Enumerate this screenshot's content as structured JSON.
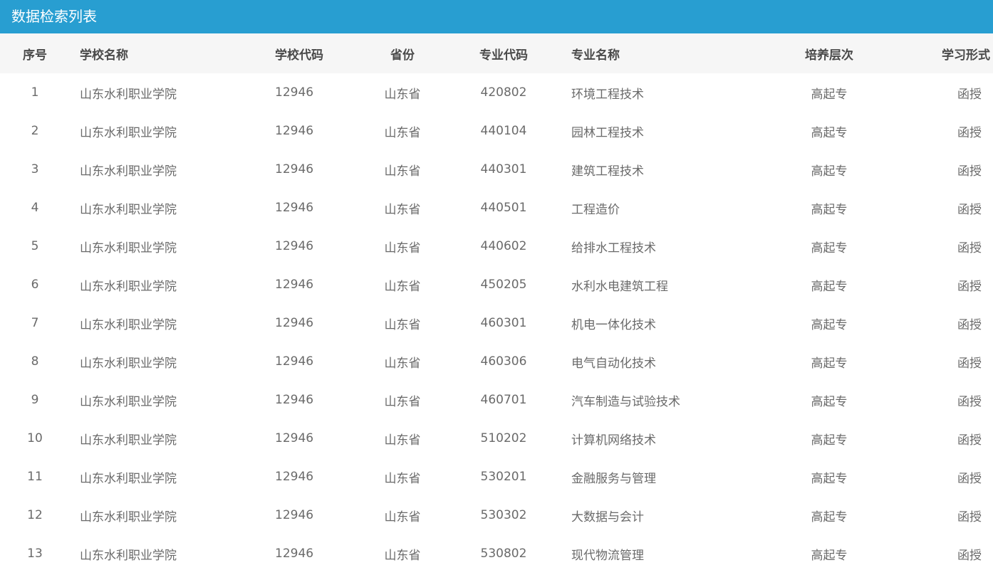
{
  "panel": {
    "title": "数据检索列表"
  },
  "table": {
    "columns": [
      "序号",
      "学校名称",
      "学校代码",
      "省份",
      "专业代码",
      "专业名称",
      "培养层次",
      "学习形式"
    ],
    "rows": [
      [
        "1",
        "山东水利职业学院",
        "12946",
        "山东省",
        "420802",
        "环境工程技术",
        "高起专",
        "函授"
      ],
      [
        "2",
        "山东水利职业学院",
        "12946",
        "山东省",
        "440104",
        "园林工程技术",
        "高起专",
        "函授"
      ],
      [
        "3",
        "山东水利职业学院",
        "12946",
        "山东省",
        "440301",
        "建筑工程技术",
        "高起专",
        "函授"
      ],
      [
        "4",
        "山东水利职业学院",
        "12946",
        "山东省",
        "440501",
        "工程造价",
        "高起专",
        "函授"
      ],
      [
        "5",
        "山东水利职业学院",
        "12946",
        "山东省",
        "440602",
        "给排水工程技术",
        "高起专",
        "函授"
      ],
      [
        "6",
        "山东水利职业学院",
        "12946",
        "山东省",
        "450205",
        "水利水电建筑工程",
        "高起专",
        "函授"
      ],
      [
        "7",
        "山东水利职业学院",
        "12946",
        "山东省",
        "460301",
        "机电一体化技术",
        "高起专",
        "函授"
      ],
      [
        "8",
        "山东水利职业学院",
        "12946",
        "山东省",
        "460306",
        "电气自动化技术",
        "高起专",
        "函授"
      ],
      [
        "9",
        "山东水利职业学院",
        "12946",
        "山东省",
        "460701",
        "汽车制造与试验技术",
        "高起专",
        "函授"
      ],
      [
        "10",
        "山东水利职业学院",
        "12946",
        "山东省",
        "510202",
        "计算机网络技术",
        "高起专",
        "函授"
      ],
      [
        "11",
        "山东水利职业学院",
        "12946",
        "山东省",
        "530201",
        "金融服务与管理",
        "高起专",
        "函授"
      ],
      [
        "12",
        "山东水利职业学院",
        "12946",
        "山东省",
        "530302",
        "大数据与会计",
        "高起专",
        "函授"
      ],
      [
        "13",
        "山东水利职业学院",
        "12946",
        "山东省",
        "530802",
        "现代物流管理",
        "高起专",
        "函授"
      ]
    ]
  }
}
